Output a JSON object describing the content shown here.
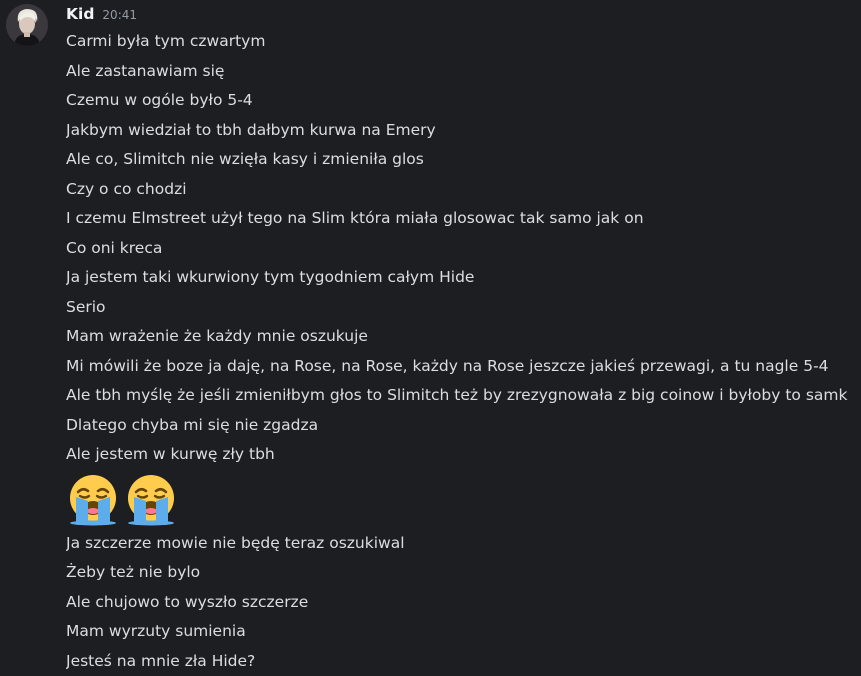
{
  "author": {
    "name": "Kid",
    "time": "20:41"
  },
  "messages_a": [
    "Carmi była tym czwartym",
    "Ale zastanawiam się",
    "Czemu w ogóle było 5-4",
    "Jakbym wiedział to tbh dałbym kurwa na Emery",
    "Ale co, Slimitch nie wzięła kasy i zmieniła glos",
    "Czy o co chodzi",
    "I czemu Elmstreet użył tego na Slim która miała glosowac tak samo jak on",
    "Co oni kreca",
    "Ja jestem taki wkurwiony tym tygodniem całym Hide",
    "Serio",
    "Mam wrażenie że każdy mnie oszukuje",
    "Mi mówili że boze ja daję, na Rose, na Rose, każdy na Rose jeszcze jakieś przewagi, a tu nagle 5-4",
    "Ale tbh myślę że jeśli zmieniłbym głos to Slimitch też by zrezygnowała z big coinow i byłoby to samk",
    "Dlatego chyba mi się nie zgadza",
    "Ale jestem w kurwę zły tbh"
  ],
  "emoji_message": {
    "emojis": [
      "loudly-crying-face",
      "loudly-crying-face"
    ]
  },
  "messages_b": [
    "Ja szczerze mowie nie będę teraz oszukiwal",
    "Żeby też nie bylo",
    "Ale chujowo to wyszło szczerze",
    "Mam wyrzuty sumienia",
    "Jesteś na mnie zła Hide?"
  ]
}
